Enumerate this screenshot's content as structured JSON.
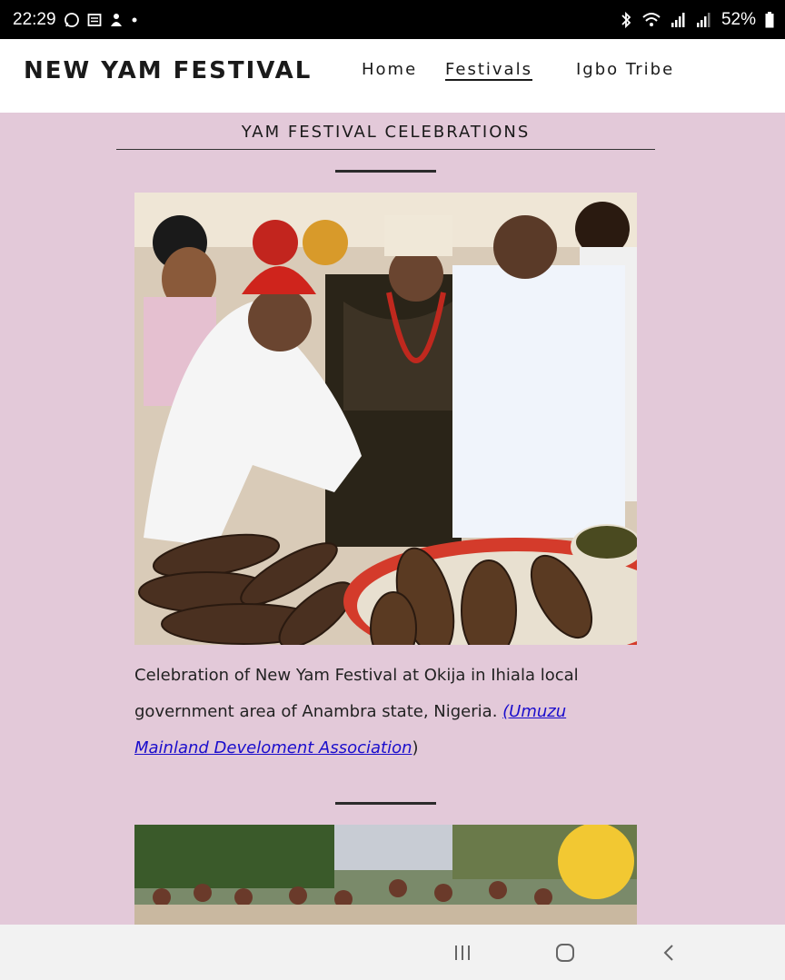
{
  "status_bar": {
    "time": "22:29",
    "battery": "52%",
    "left_icons": [
      "whatsapp-icon",
      "message-icon",
      "notification-icon",
      "dot-icon"
    ],
    "right_icons": [
      "bluetooth-icon",
      "wifi-icon",
      "signal-icon",
      "signal-icon",
      "battery-icon"
    ]
  },
  "header": {
    "title": "NEW YAM FESTIVAL",
    "nav": [
      "Home",
      "Festivals",
      "Igbo Tribe"
    ],
    "active_nav": "Festivals"
  },
  "section": {
    "title": "YAM FESTIVAL CELEBRATIONS"
  },
  "caption": {
    "text": "Celebration of New Yam Festival at Okija in Ihiala local government area of Anambra state, Nigeria. ",
    "open_paren": "(",
    "link_text": "Umuzu Mainland Develoment Association",
    "close_paren": ")"
  },
  "colors": {
    "background": "#e3c9d9",
    "header_bg": "#ffffff",
    "link": "#1a0dcc"
  },
  "nav_bar": {
    "buttons": [
      "recents-icon",
      "home-icon",
      "back-icon"
    ]
  }
}
